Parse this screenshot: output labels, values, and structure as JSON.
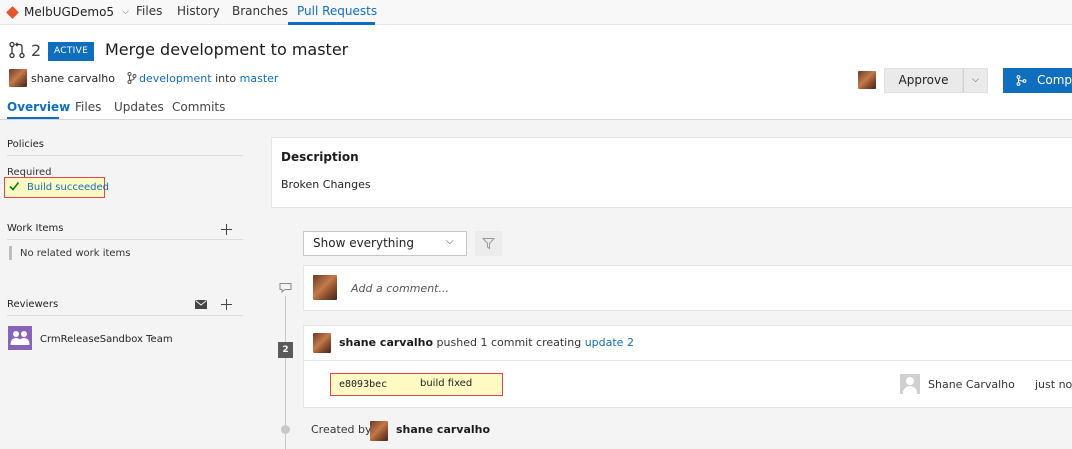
{
  "nav": {
    "repo_name": "MelbUGDemo5",
    "repo_icon": "git-icon",
    "items": [
      "Files",
      "History",
      "Branches",
      "Pull Requests"
    ],
    "active_item": "Pull Requests"
  },
  "pr": {
    "number": "2",
    "status": "ACTIVE",
    "title": "Merge development to master",
    "author": "shane carvalho",
    "source_branch": "development",
    "into_text": "into",
    "target_branch": "master",
    "approve_label": "Approve",
    "complete_label": "Complete"
  },
  "tabs": [
    "Overview",
    "Files",
    "Updates",
    "Commits"
  ],
  "sidebar": {
    "policies_title": "Policies",
    "required_label": "Required",
    "build_status": "Build succeeded",
    "work_items_title": "Work Items",
    "no_work_items": "No related work items",
    "reviewers_title": "Reviewers",
    "reviewer_team": "CrmReleaseSandbox Team"
  },
  "description": {
    "title": "Description",
    "body": "Broken Changes"
  },
  "activity": {
    "filter_value": "Show everything",
    "comment_placeholder": "Add a comment...",
    "update_number": "2",
    "push_author": "shane carvalho",
    "push_text": "pushed 1 commit creating",
    "push_link": "update 2",
    "commit_hash": "e8093bec",
    "commit_message": "build fixed",
    "committer": "Shane Carvalho",
    "commit_time": "just now",
    "created_by_label": "Created by",
    "created_by_name": "shane carvalho"
  },
  "colors": {
    "accent": "#106ebe",
    "highlight_bg": "#fff9c4",
    "highlight_border": "#e04848",
    "team_icon": "#8764b8"
  }
}
